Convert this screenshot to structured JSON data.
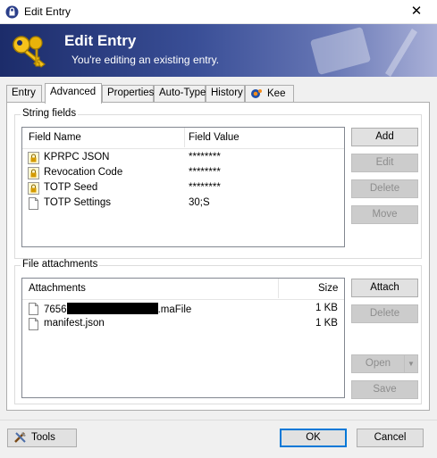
{
  "window": {
    "title": "Edit Entry",
    "close_glyph": "✕"
  },
  "banner": {
    "title": "Edit Entry",
    "subtitle": "You're editing an existing entry."
  },
  "tabs": [
    {
      "label": "Entry"
    },
    {
      "label": "Advanced",
      "active": true
    },
    {
      "label": "Properties"
    },
    {
      "label": "Auto-Type"
    },
    {
      "label": "History"
    },
    {
      "label": "Kee"
    }
  ],
  "string_fields": {
    "legend": "String fields",
    "columns": [
      "Field Name",
      "Field Value"
    ],
    "rows": [
      {
        "name": "KPRPC JSON",
        "value": "********",
        "icon": "lock-icon"
      },
      {
        "name": "Revocation Code",
        "value": "********",
        "icon": "lock-icon"
      },
      {
        "name": "TOTP Seed",
        "value": "********",
        "icon": "lock-icon"
      },
      {
        "name": "TOTP Settings",
        "value": "30;S",
        "icon": "document-icon"
      }
    ],
    "buttons": {
      "add": "Add",
      "edit": "Edit",
      "delete": "Delete",
      "move": "Move"
    }
  },
  "attachments": {
    "legend": "File attachments",
    "columns": [
      "Attachments",
      "Size"
    ],
    "rows": [
      {
        "name_prefix": "7656",
        "name_suffix": ".maFile",
        "size": "1 KB"
      },
      {
        "name": "manifest.json",
        "size": "1 KB"
      }
    ],
    "buttons": {
      "attach": "Attach",
      "delete": "Delete",
      "open": "Open",
      "save": "Save"
    }
  },
  "footer": {
    "tools": "Tools",
    "ok": "OK",
    "cancel": "Cancel"
  },
  "colors": {
    "accent": "#0078d7",
    "banner_dark": "#1c2c6a",
    "banner_light": "#aab1d8"
  }
}
